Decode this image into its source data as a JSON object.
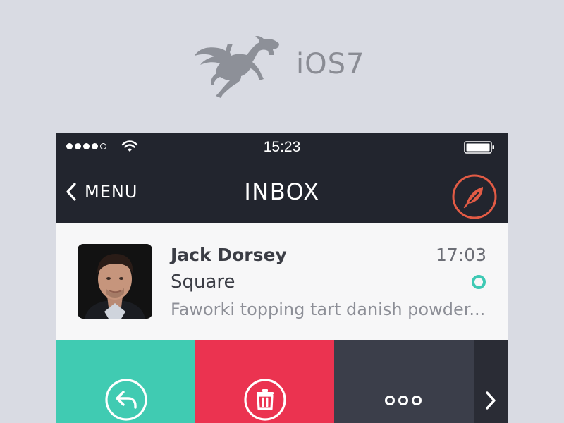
{
  "brand": {
    "logo_icon": "pegasus-icon",
    "text": "iOS7"
  },
  "status_bar": {
    "signal_bars_filled": 4,
    "signal_bars_total": 5,
    "wifi_icon": "wifi-icon",
    "time": "15:23",
    "battery_icon": "battery-icon"
  },
  "nav": {
    "back_label": "MENU",
    "back_icon": "chevron-left-icon",
    "title": "INBOX",
    "compose_icon": "feather-icon"
  },
  "message": {
    "sender": "Jack Dorsey",
    "time": "17:03",
    "subject": "Square",
    "preview": "Faworki topping tart danish powder...",
    "unread": true
  },
  "actions": [
    {
      "name": "reply",
      "icon": "reply-icon"
    },
    {
      "name": "delete",
      "icon": "trash-icon"
    },
    {
      "name": "more",
      "icon": "more-icon"
    },
    {
      "name": "next",
      "icon": "chevron-right-icon"
    }
  ],
  "colors": {
    "background": "#d9dbe3",
    "navbar": "#22252e",
    "accent_compose": "#e25b45",
    "reply": "#40cbb2",
    "delete": "#eb3350",
    "more": "#3b3e4a",
    "next": "#2a2c35",
    "unread": "#3ec9b4"
  }
}
